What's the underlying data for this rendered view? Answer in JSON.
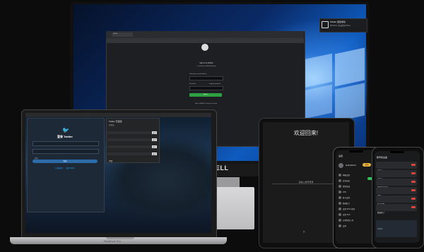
{
  "monitor": {
    "brand": "DELL",
    "browser": {
      "tab_label": "GitHub",
      "signin_title": "Sign in to GitHub",
      "signin_subtitle": "to continue to GitHub Desktop",
      "username_label": "Username or email address",
      "password_label": "Password",
      "forgot_label": "Forgot password?",
      "signin_button": "Sign in",
      "new_account": "New to GitHub? Create an account."
    },
    "toast": {
      "title": "Fiddler 连接成功",
      "body": "Windows 已连接到 iPhone"
    }
  },
  "laptop": {
    "label": "MacBook Pro",
    "menubar_app": "Safari浏览器",
    "twitter": {
      "title": "登录 Twitter",
      "username_placeholder": "手机、邮件地址或用户名",
      "password_placeholder": "密码",
      "login_button": "登录",
      "footer_links": "忘记密码？ · 注册 Twitter"
    },
    "extension": {
      "title": "Twitter 已连接",
      "status": "已登录",
      "rows": [
        {
          "label": "推文",
          "value": "运行"
        },
        {
          "label": "关注",
          "value": "运行"
        },
        {
          "label": "Cookie",
          "value": "运行"
        },
        {
          "label": "代理",
          "value": "运行"
        }
      ]
    }
  },
  "tablet": {
    "title": "欢迎回来!",
    "subtitle": "请输入账号登录"
  },
  "phone1": {
    "header": "设置",
    "user": "HelloWorld",
    "badge": "会员",
    "menu": [
      "网络设置",
      "蓝牙连接",
      "智能加速",
      "VPN",
      "账号设置",
      "数据统计",
      "设置 Wi-Fi 密码",
      "设置 IPv6",
      "应用管理工具",
      "设置"
    ]
  },
  "phone2": {
    "header": "账号和设备",
    "rows": [
      "设备 1",
      "设备 2",
      "智能加速设备",
      "VPN",
      "账号设置",
      "数据统计"
    ],
    "footer": "Twitter"
  }
}
